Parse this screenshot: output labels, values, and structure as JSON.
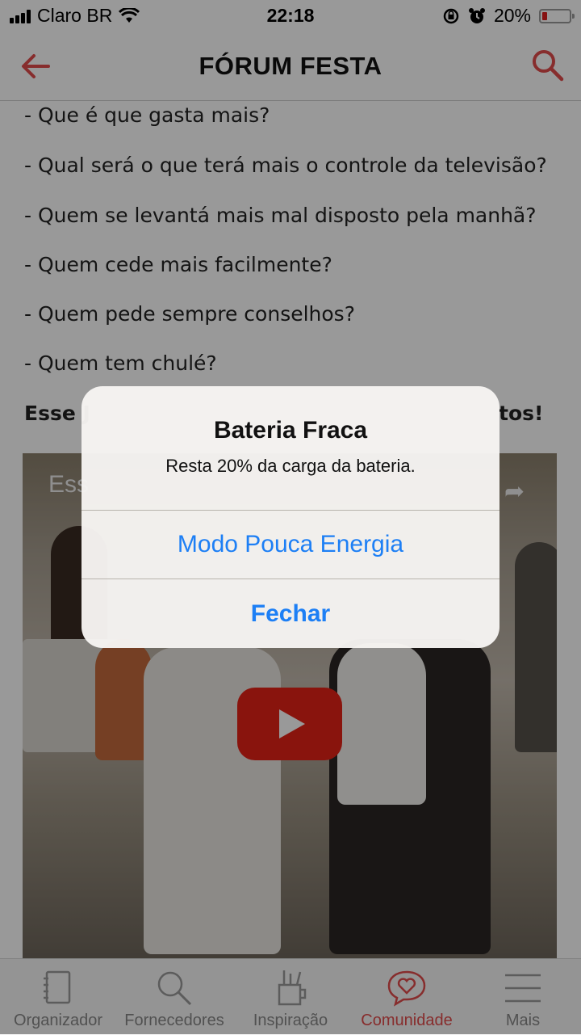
{
  "status_bar": {
    "carrier": "Claro BR",
    "time": "22:18",
    "battery_percent": "20%",
    "battery_level": 0.2
  },
  "header": {
    "title": "FÓRUM FESTA",
    "back_icon": "arrow-left-icon",
    "search_icon": "search-icon",
    "accent_color": "#e14b4b"
  },
  "content": {
    "lines": [
      "- Que é que gasta mais?",
      "- Qual será o que terá mais o controle da televisão?",
      "- Quem se levantá mais mal disposto pela manhã?",
      "- Quem cede mais facilmente?",
      "- Quem pede sempre conselhos?",
      "- Quem tem chulé?"
    ],
    "bold_line_start": "Esse J",
    "bold_line_end": "tos!",
    "video": {
      "title_fragment": "Ess",
      "play_icon": "play-icon"
    }
  },
  "alert": {
    "title": "Bateria Fraca",
    "message": "Resta 20% da carga da bateria.",
    "primary_action": "Modo Pouca Energia",
    "dismiss_action": "Fechar"
  },
  "tabbar": {
    "items": [
      {
        "label": "Organizador",
        "icon": "notebook-icon"
      },
      {
        "label": "Fornecedores",
        "icon": "search-icon"
      },
      {
        "label": "Inspiração",
        "icon": "tools-cup-icon"
      },
      {
        "label": "Comunidade",
        "icon": "heart-chat-icon"
      },
      {
        "label": "Mais",
        "icon": "menu-icon"
      }
    ],
    "active_index": 3
  }
}
